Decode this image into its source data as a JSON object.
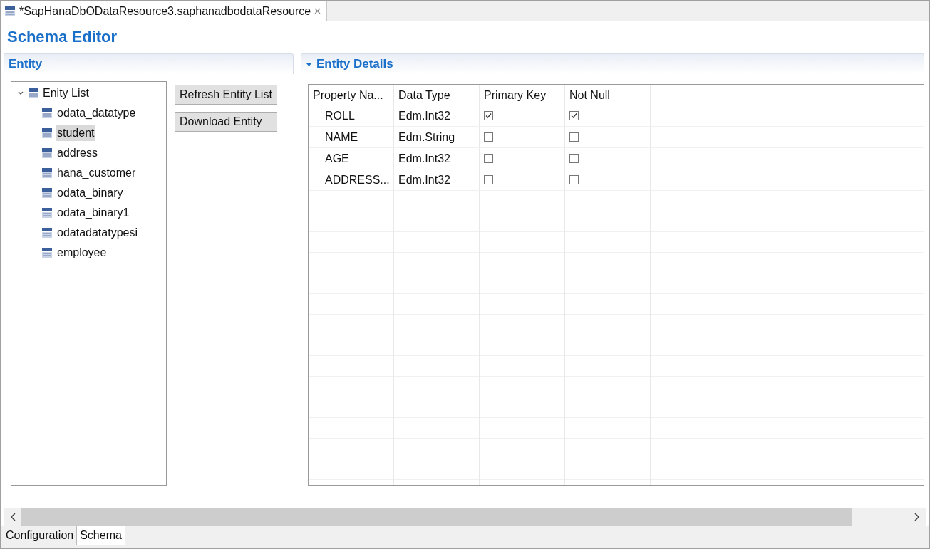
{
  "editor_tab": {
    "title": "*SapHanaDbODataResource3.saphanadbodataResource"
  },
  "page_title": "Schema Editor",
  "entity_section": {
    "title": "Entity",
    "tree": {
      "label": "Enity List",
      "expanded": true,
      "selected": false,
      "children": [
        {
          "label": "odata_datatype",
          "selected": false
        },
        {
          "label": "student",
          "selected": true
        },
        {
          "label": "address",
          "selected": false
        },
        {
          "label": "hana_customer",
          "selected": false
        },
        {
          "label": "odata_binary",
          "selected": false
        },
        {
          "label": "odata_binary1",
          "selected": false
        },
        {
          "label": "odatadatatypesi",
          "selected": false
        },
        {
          "label": "employee",
          "selected": false
        }
      ]
    },
    "buttons": [
      "Refresh Entity List",
      "Download Entity"
    ]
  },
  "details_section": {
    "title": "Entity Details",
    "expanded": true,
    "table": {
      "columns": [
        "Property Na...",
        "Data Type",
        "Primary Key",
        "Not Null"
      ],
      "rows": [
        {
          "property": "ROLL",
          "data_type": "Edm.Int32",
          "primary_key": true,
          "not_null": true
        },
        {
          "property": "NAME",
          "data_type": "Edm.String",
          "primary_key": false,
          "not_null": false
        },
        {
          "property": "AGE",
          "data_type": "Edm.Int32",
          "primary_key": false,
          "not_null": false
        },
        {
          "property": "ADDRESS...",
          "data_type": "Edm.Int32",
          "primary_key": false,
          "not_null": false
        }
      ]
    }
  },
  "bottom_tabs": [
    {
      "label": "Configuration",
      "selected": false
    },
    {
      "label": "Schema",
      "selected": true
    }
  ]
}
